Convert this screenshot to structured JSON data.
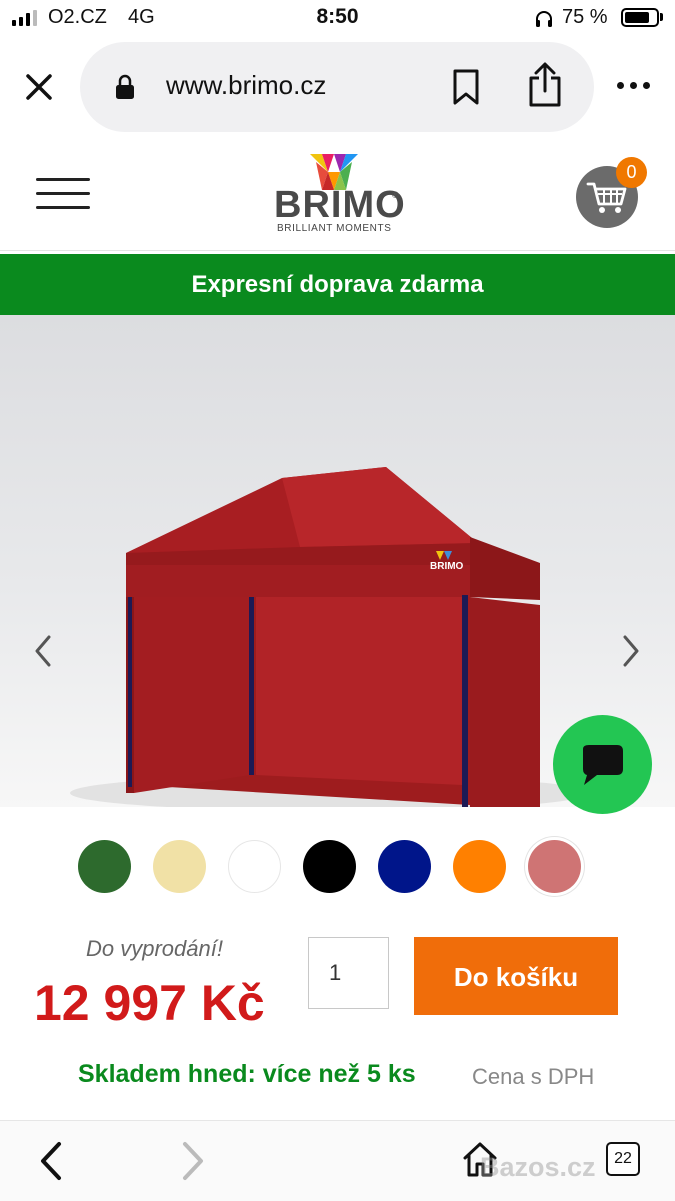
{
  "status_bar": {
    "carrier": "O2.CZ",
    "network": "4G",
    "time": "8:50",
    "battery_text": "75 %",
    "battery_level": 0.75
  },
  "browser": {
    "url": "www.brimo.cz"
  },
  "site": {
    "logo_text": "BRIMO",
    "logo_tagline": "BRILLIANT MOMENTS",
    "cart_count": "0"
  },
  "promo_banner": "Expresní doprava zdarma",
  "product": {
    "image_icon": "red-party-tent",
    "tent_logo_text": "BRIMO",
    "color_swatches": [
      "#2d6a2d",
      "#f1e1a6",
      "#ffffff",
      "#000000",
      "#00158a",
      "#ff8000",
      "#cf7474"
    ],
    "sale_label": "Do vyprodání!",
    "price": "12 997 Kč",
    "quantity": "1",
    "add_to_cart_label": "Do košíku",
    "stock_text": "Skladem hned: více než 5 ks",
    "vat_note": "Cena s DPH"
  },
  "bottom_nav": {
    "tab_count": "22",
    "watermark": "Bazos.cz"
  },
  "colors": {
    "promo_green": "#0a8a1e",
    "price_red": "#d11a1a",
    "cta_orange": "#f06d0a",
    "chat_green": "#23c653"
  }
}
